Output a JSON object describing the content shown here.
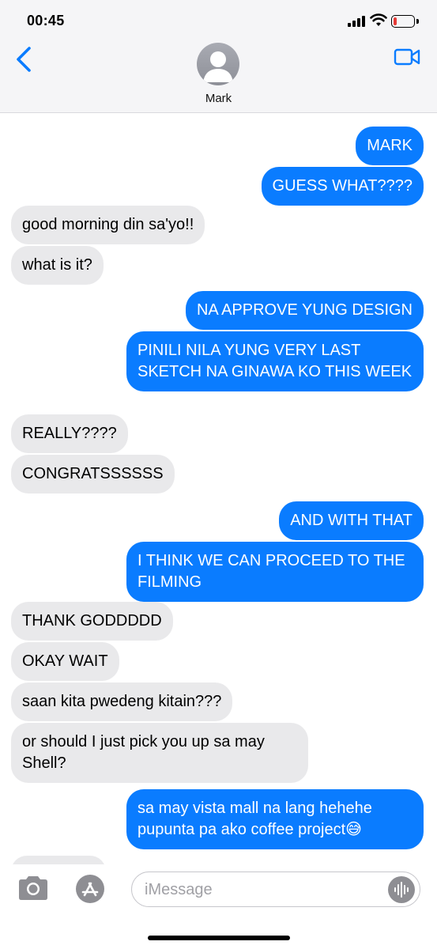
{
  "status_bar": {
    "time": "00:45",
    "battery_level": 0.2
  },
  "header": {
    "contact_name": "Mark",
    "back_icon": "chevron-left-icon",
    "video_icon": "video-camera-icon"
  },
  "messages": [
    {
      "direction": "sent",
      "text": "MARK"
    },
    {
      "direction": "sent",
      "text": "GUESS WHAT????"
    },
    {
      "direction": "received",
      "text": "good morning din sa'yo!!"
    },
    {
      "direction": "received",
      "text": "what is it?"
    },
    {
      "direction": "sent",
      "text": "NA APPROVE YUNG DESIGN"
    },
    {
      "direction": "sent",
      "text": "PINILI NILA YUNG VERY LAST SKETCH NA GINAWA KO THIS WEEK"
    },
    {
      "direction": "received",
      "text": "REALLY????"
    },
    {
      "direction": "received",
      "text": "CONGRATSSSSSS"
    },
    {
      "direction": "sent",
      "text": "AND WITH THAT"
    },
    {
      "direction": "sent",
      "text": "I THINK WE CAN PROCEED TO THE FILMING"
    },
    {
      "direction": "received",
      "text": "THANK GODDDDD"
    },
    {
      "direction": "received",
      "text": "OKAY WAIT"
    },
    {
      "direction": "received",
      "text": "saan kita pwedeng kitain???"
    },
    {
      "direction": "received",
      "text": "or should I just pick you up sa may Shell?"
    },
    {
      "direction": "sent",
      "text": "sa may vista mall na lang hehehe pupunta pa ako coffee project😅"
    }
  ],
  "composer": {
    "placeholder": "iMessage",
    "camera_icon": "camera-icon",
    "appstore_icon": "app-store-icon",
    "audio_icon": "audio-waveform-icon"
  }
}
